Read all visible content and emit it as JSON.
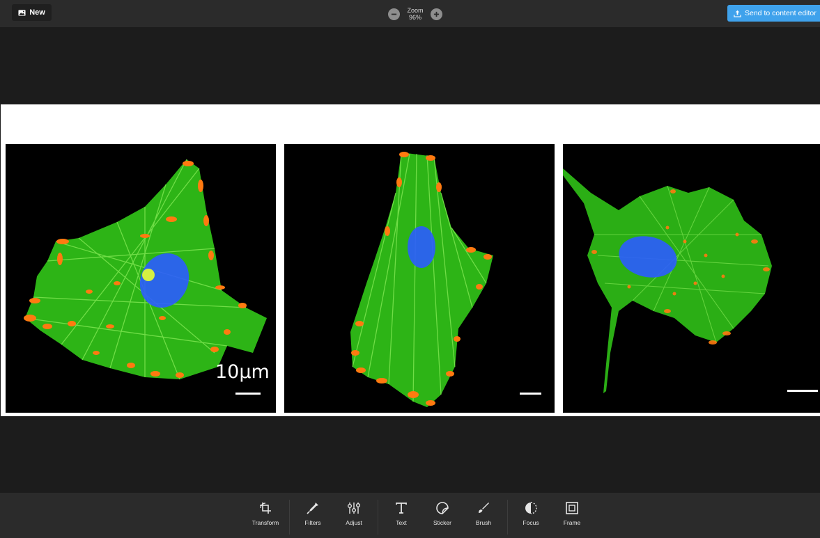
{
  "header": {
    "new_label": "New",
    "zoom_label": "Zoom",
    "zoom_value": "96%",
    "send_label": "Send to content editor"
  },
  "image": {
    "scale_bar_label": "10µm"
  },
  "toolbar": {
    "tools": [
      {
        "label": "Transform",
        "icon": "crop-rotate-icon"
      },
      {
        "label": "Filters",
        "icon": "dropper-icon"
      },
      {
        "label": "Adjust",
        "icon": "sliders-icon"
      },
      {
        "label": "Text",
        "icon": "text-icon"
      },
      {
        "label": "Sticker",
        "icon": "sticker-icon"
      },
      {
        "label": "Brush",
        "icon": "brush-icon"
      },
      {
        "label": "Focus",
        "icon": "focus-icon"
      },
      {
        "label": "Frame",
        "icon": "frame-icon"
      }
    ]
  },
  "colors": {
    "accent": "#3fa2ec",
    "topbar": "#2b2b2b",
    "canvas": "#1c1c1c",
    "actin": "#35d41a",
    "focal_adhesion": "#ff7a10",
    "nucleus": "#2b5cff"
  }
}
